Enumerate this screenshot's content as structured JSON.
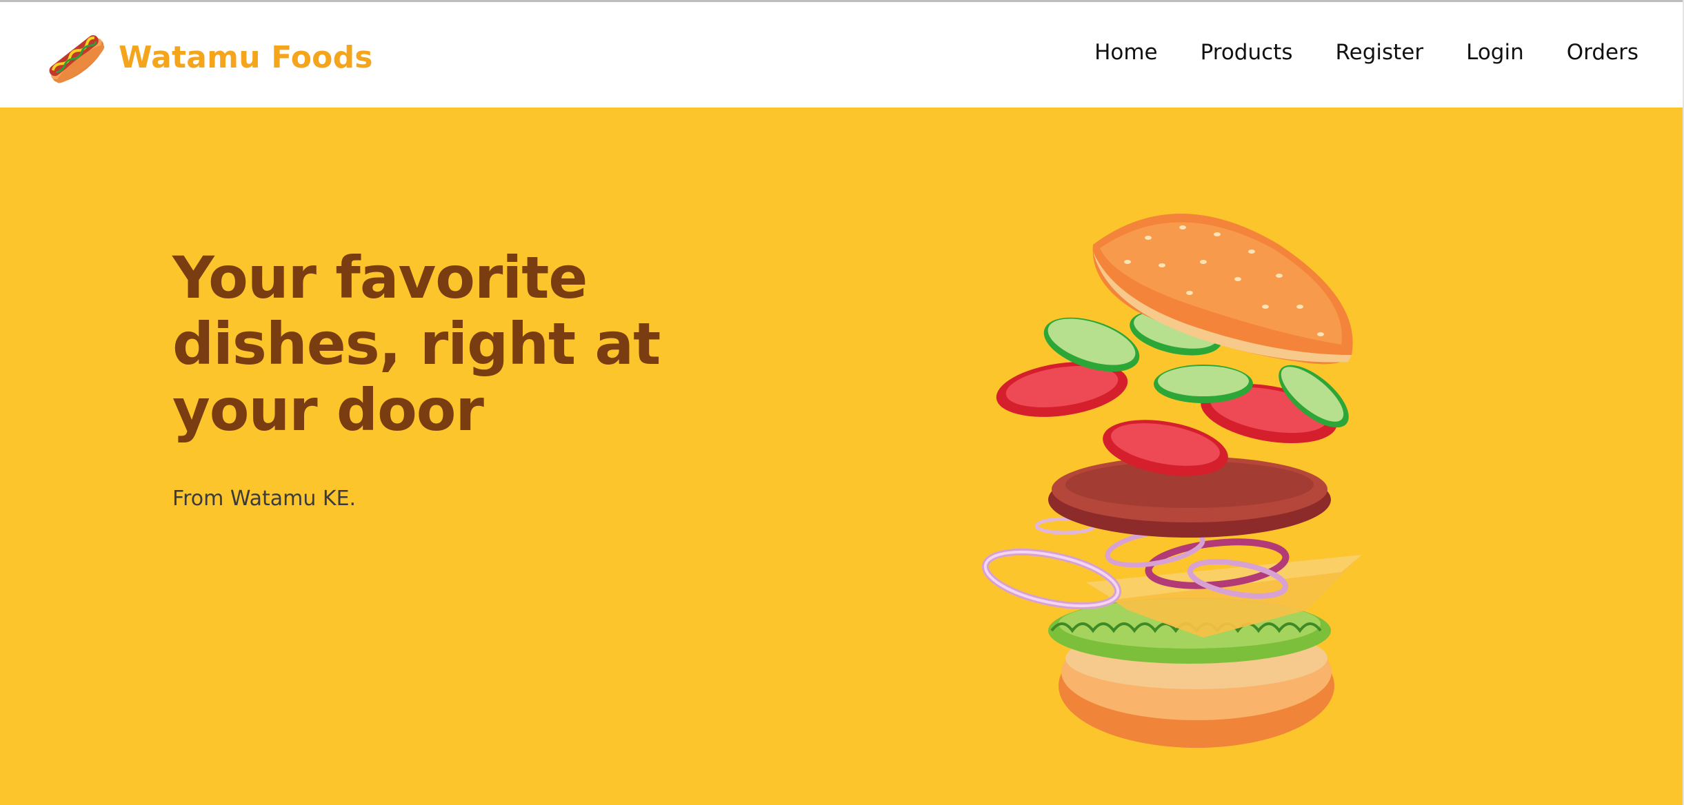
{
  "brand": {
    "name": "Watamu Foods",
    "logo_icon": "hot-dog-icon",
    "color": "#f4a51c"
  },
  "nav": {
    "links": [
      {
        "label": "Home"
      },
      {
        "label": "Products"
      },
      {
        "label": "Register"
      },
      {
        "label": "Login"
      },
      {
        "label": "Orders"
      }
    ]
  },
  "hero": {
    "title": "Your favorite dishes, right at your door",
    "subtitle": "From Watamu KE.",
    "background": "#fdc52c",
    "title_color": "#7a3d12",
    "image_icon": "exploded-burger-illustration"
  }
}
